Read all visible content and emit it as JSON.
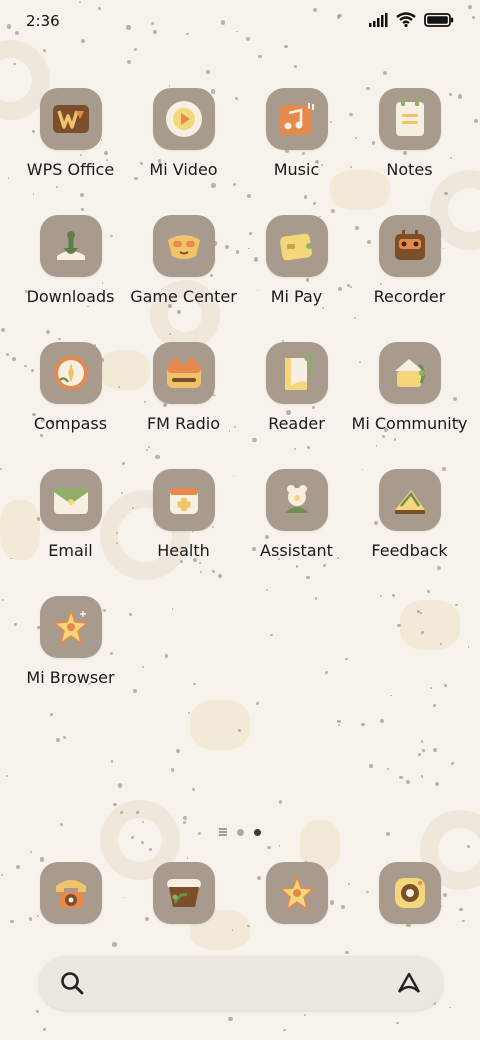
{
  "status_bar": {
    "time": "2:36",
    "icons": [
      "signal-icon",
      "wifi-icon",
      "battery-icon"
    ]
  },
  "apps": [
    {
      "label": "WPS Office",
      "icon": "wps-office-icon"
    },
    {
      "label": "Mi Video",
      "icon": "mi-video-icon"
    },
    {
      "label": "Music",
      "icon": "music-icon"
    },
    {
      "label": "Notes",
      "icon": "notes-icon"
    },
    {
      "label": "Downloads",
      "icon": "downloads-icon"
    },
    {
      "label": "Game Center",
      "icon": "game-center-icon"
    },
    {
      "label": "Mi Pay",
      "icon": "mi-pay-icon"
    },
    {
      "label": "Recorder",
      "icon": "recorder-icon"
    },
    {
      "label": "Compass",
      "icon": "compass-icon"
    },
    {
      "label": "FM Radio",
      "icon": "fm-radio-icon"
    },
    {
      "label": "Reader",
      "icon": "reader-icon"
    },
    {
      "label": "Mi Community",
      "icon": "mi-community-icon"
    },
    {
      "label": "Email",
      "icon": "email-icon"
    },
    {
      "label": "Health",
      "icon": "health-icon"
    },
    {
      "label": "Assistant",
      "icon": "assistant-icon"
    },
    {
      "label": "Feedback",
      "icon": "feedback-icon"
    },
    {
      "label": "Mi Browser",
      "icon": "mi-browser-icon"
    }
  ],
  "page_indicator": {
    "pages": 2,
    "active": 2
  },
  "dock": [
    {
      "icon": "phone-icon"
    },
    {
      "icon": "messages-icon"
    },
    {
      "icon": "browser-icon"
    },
    {
      "icon": "camera-icon"
    }
  ],
  "search_bar": {
    "icons": [
      "search-icon",
      "assistant-a-icon"
    ]
  },
  "colors": {
    "background": "#f7f3ec",
    "icon_tile": "#a89a8d",
    "accent_yellow": "#f3d77a",
    "accent_orange": "#e58a4c",
    "accent_green": "#6f8f4c"
  }
}
